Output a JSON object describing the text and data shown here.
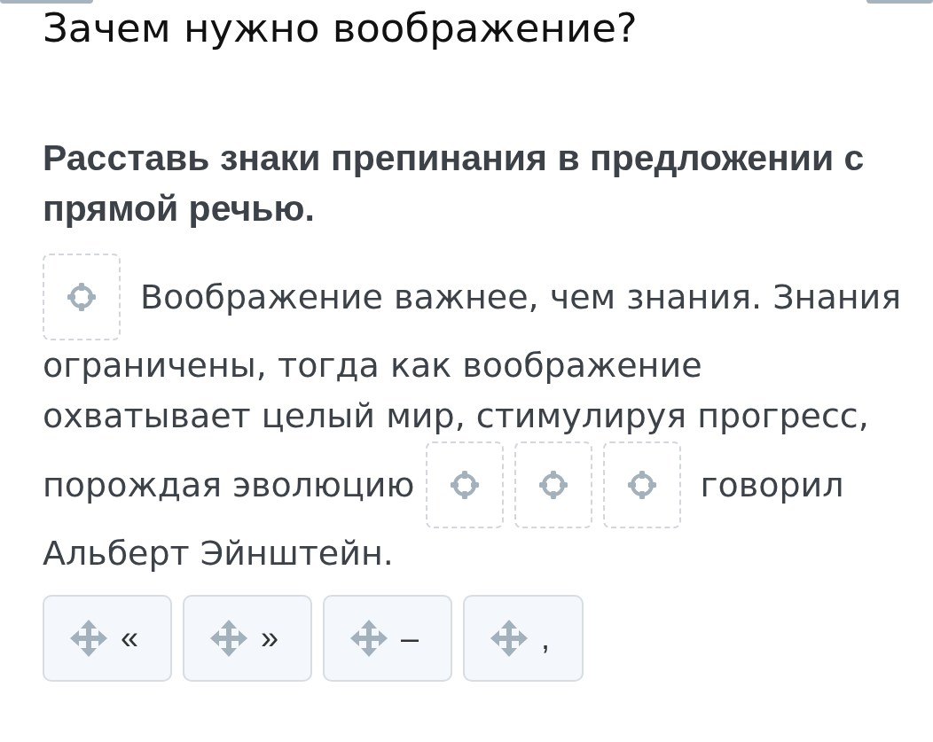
{
  "title": "Зачем нужно воображение?",
  "instruction": "Расставь знаки препинания в предложении с прямой речью.",
  "sentence_lines": [
    [
      {
        "kind": "slot"
      },
      {
        "kind": "text",
        "text": "Воображение важнее, чем знания. Знания"
      }
    ],
    [
      {
        "kind": "text",
        "text": "ограничены, тогда как воображение"
      }
    ],
    [
      {
        "kind": "text",
        "text": "охватывает целый мир, стимулируя прогресс,"
      }
    ],
    [
      {
        "kind": "text",
        "text": "порождая эволюцию"
      },
      {
        "kind": "slot"
      },
      {
        "kind": "slot"
      },
      {
        "kind": "slot"
      },
      {
        "kind": "text",
        "text": "говорил"
      }
    ],
    [
      {
        "kind": "text",
        "text": "Альберт Эйнштейн."
      }
    ]
  ],
  "options": [
    {
      "label": "«"
    },
    {
      "label": "»"
    },
    {
      "label": "–"
    },
    {
      "label": ","
    }
  ]
}
